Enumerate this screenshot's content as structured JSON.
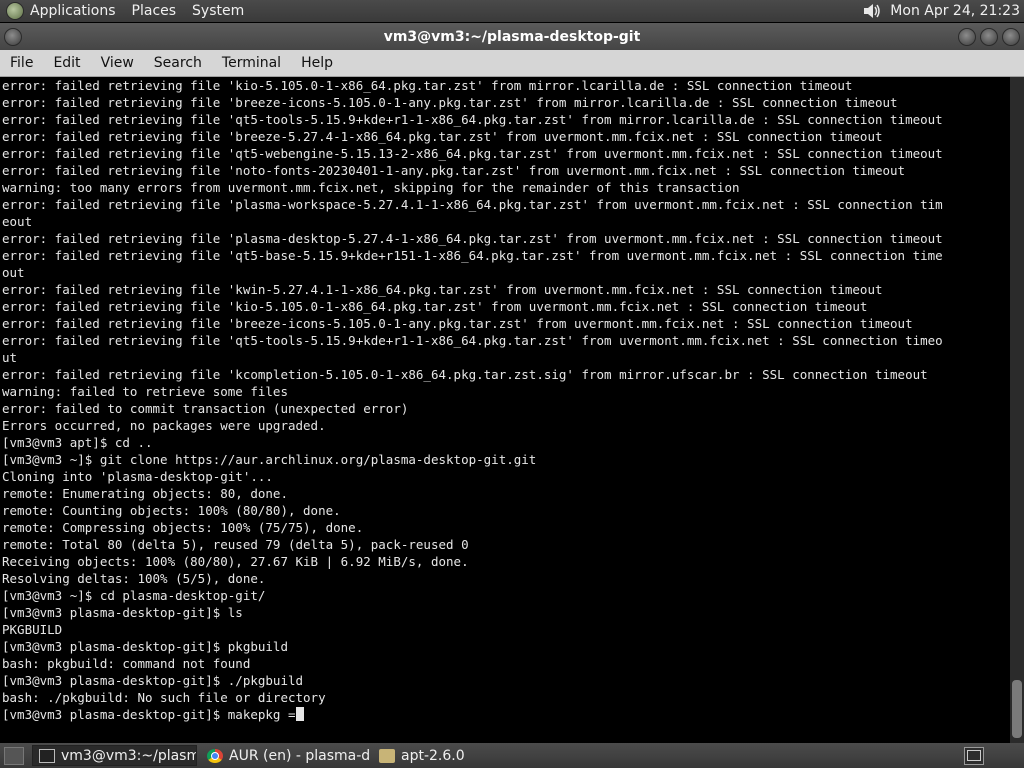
{
  "top_panel": {
    "menus": [
      "Applications",
      "Places",
      "System"
    ],
    "clock": "Mon Apr 24, 21:23"
  },
  "window": {
    "title": "vm3@vm3:~/plasma-desktop-git"
  },
  "menubar": [
    "File",
    "Edit",
    "View",
    "Search",
    "Terminal",
    "Help"
  ],
  "terminal": {
    "lines": [
      "error: failed retrieving file 'kio-5.105.0-1-x86_64.pkg.tar.zst' from mirror.lcarilla.de : SSL connection timeout",
      "error: failed retrieving file 'breeze-icons-5.105.0-1-any.pkg.tar.zst' from mirror.lcarilla.de : SSL connection timeout",
      "error: failed retrieving file 'qt5-tools-5.15.9+kde+r1-1-x86_64.pkg.tar.zst' from mirror.lcarilla.de : SSL connection timeout",
      "error: failed retrieving file 'breeze-5.27.4-1-x86_64.pkg.tar.zst' from uvermont.mm.fcix.net : SSL connection timeout",
      "error: failed retrieving file 'qt5-webengine-5.15.13-2-x86_64.pkg.tar.zst' from uvermont.mm.fcix.net : SSL connection timeout",
      "error: failed retrieving file 'noto-fonts-20230401-1-any.pkg.tar.zst' from uvermont.mm.fcix.net : SSL connection timeout",
      "warning: too many errors from uvermont.mm.fcix.net, skipping for the remainder of this transaction",
      "error: failed retrieving file 'plasma-workspace-5.27.4.1-1-x86_64.pkg.tar.zst' from uvermont.mm.fcix.net : SSL connection tim",
      "eout",
      "error: failed retrieving file 'plasma-desktop-5.27.4-1-x86_64.pkg.tar.zst' from uvermont.mm.fcix.net : SSL connection timeout",
      "error: failed retrieving file 'qt5-base-5.15.9+kde+r151-1-x86_64.pkg.tar.zst' from uvermont.mm.fcix.net : SSL connection time",
      "out",
      "error: failed retrieving file 'kwin-5.27.4.1-1-x86_64.pkg.tar.zst' from uvermont.mm.fcix.net : SSL connection timeout",
      "error: failed retrieving file 'kio-5.105.0-1-x86_64.pkg.tar.zst' from uvermont.mm.fcix.net : SSL connection timeout",
      "error: failed retrieving file 'breeze-icons-5.105.0-1-any.pkg.tar.zst' from uvermont.mm.fcix.net : SSL connection timeout",
      "error: failed retrieving file 'qt5-tools-5.15.9+kde+r1-1-x86_64.pkg.tar.zst' from uvermont.mm.fcix.net : SSL connection timeo",
      "ut",
      "error: failed retrieving file 'kcompletion-5.105.0-1-x86_64.pkg.tar.zst.sig' from mirror.ufscar.br : SSL connection timeout",
      "warning: failed to retrieve some files",
      "error: failed to commit transaction (unexpected error)",
      "Errors occurred, no packages were upgraded.",
      "[vm3@vm3 apt]$ cd ..",
      "[vm3@vm3 ~]$ git clone https://aur.archlinux.org/plasma-desktop-git.git",
      "Cloning into 'plasma-desktop-git'...",
      "remote: Enumerating objects: 80, done.",
      "remote: Counting objects: 100% (80/80), done.",
      "remote: Compressing objects: 100% (75/75), done.",
      "remote: Total 80 (delta 5), reused 79 (delta 5), pack-reused 0",
      "Receiving objects: 100% (80/80), 27.67 KiB | 6.92 MiB/s, done.",
      "Resolving deltas: 100% (5/5), done.",
      "[vm3@vm3 ~]$ cd plasma-desktop-git/",
      "[vm3@vm3 plasma-desktop-git]$ ls",
      "PKGBUILD",
      "[vm3@vm3 plasma-desktop-git]$ pkgbuild",
      "bash: pkgbuild: command not found",
      "[vm3@vm3 plasma-desktop-git]$ ./pkgbuild",
      "bash: ./pkgbuild: No such file or directory"
    ],
    "prompt_line": "[vm3@vm3 plasma-desktop-git]$ makepkg ="
  },
  "taskbar": {
    "tasks": [
      {
        "label": "vm3@vm3:~/plasm...",
        "icon": "terminal-icon",
        "active": true
      },
      {
        "label": "AUR (en) - plasma-d...",
        "icon": "chrome-icon",
        "active": false
      },
      {
        "label": "apt-2.6.0",
        "icon": "folder-icon",
        "active": false
      }
    ]
  }
}
